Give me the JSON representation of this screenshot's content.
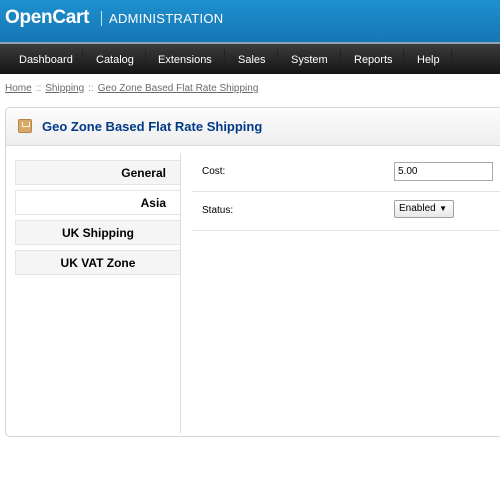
{
  "header": {
    "logo": "OpenCart",
    "subtitle": "ADMINISTRATION"
  },
  "menu": {
    "items": [
      {
        "label": "Dashboard"
      },
      {
        "label": "Catalog"
      },
      {
        "label": "Extensions"
      },
      {
        "label": "Sales"
      },
      {
        "label": "System"
      },
      {
        "label": "Reports"
      },
      {
        "label": "Help"
      }
    ]
  },
  "breadcrumb": {
    "items": [
      "Home",
      "Shipping",
      "Geo Zone Based Flat Rate Shipping"
    ],
    "separator": "::"
  },
  "box": {
    "title": "Geo Zone Based Flat Rate Shipping"
  },
  "tabs": [
    {
      "label": "General",
      "selected": false
    },
    {
      "label": "Asia",
      "selected": true
    },
    {
      "label": "UK Shipping",
      "selected": false
    },
    {
      "label": "UK VAT Zone",
      "selected": false
    }
  ],
  "form": {
    "cost_label": "Cost:",
    "cost_value": "5.00",
    "status_label": "Status:",
    "status_value": "Enabled",
    "status_arrow": "▼"
  },
  "colors": {
    "header_blue": "#1e91cf",
    "title_blue": "#003a88"
  }
}
